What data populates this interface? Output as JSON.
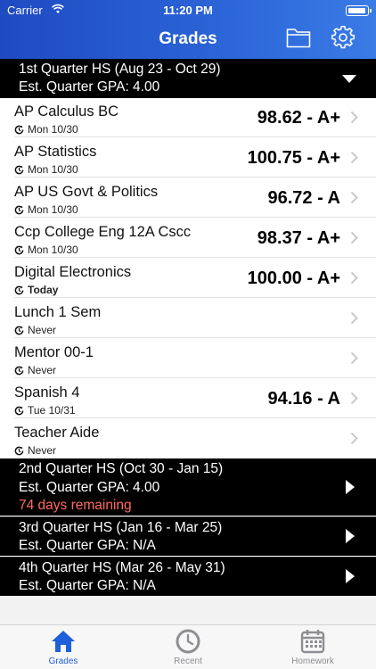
{
  "status_bar": {
    "carrier": "Carrier",
    "time": "11:20 PM"
  },
  "nav": {
    "title": "Grades"
  },
  "quarter1": {
    "title": "1st Quarter HS (Aug 23 - Oct 29)",
    "gpa": "Est. Quarter GPA: 4.00"
  },
  "courses": [
    {
      "name": "AP Calculus BC",
      "updated": "Mon 10/30",
      "grade": "98.62 - A+"
    },
    {
      "name": "AP Statistics",
      "updated": "Mon 10/30",
      "grade": "100.75 - A+"
    },
    {
      "name": "AP US Govt & Politics",
      "updated": "Mon 10/30",
      "grade": "96.72 - A"
    },
    {
      "name": "Ccp College Eng 12A Cscc",
      "updated": "Mon 10/30",
      "grade": "98.37 - A+"
    },
    {
      "name": "Digital Electronics",
      "updated": "Today",
      "grade": "100.00 - A+"
    },
    {
      "name": "Lunch 1 Sem",
      "updated": "Never",
      "grade": ""
    },
    {
      "name": "Mentor 00-1",
      "updated": "Never",
      "grade": ""
    },
    {
      "name": "Spanish 4",
      "updated": "Tue 10/31",
      "grade": "94.16 - A"
    },
    {
      "name": "Teacher Aide",
      "updated": "Never",
      "grade": ""
    }
  ],
  "quarter2": {
    "title": "2nd Quarter HS (Oct 30 - Jan 15)",
    "gpa": "Est. Quarter GPA: 4.00",
    "remaining": "74 days remaining"
  },
  "quarter3": {
    "title": "3rd Quarter HS (Jan 16 - Mar 25)",
    "gpa": "Est. Quarter GPA: N/A"
  },
  "quarter4": {
    "title": "4th Quarter HS (Mar 26 - May 31)",
    "gpa": "Est. Quarter GPA: N/A"
  },
  "tabs": {
    "grades": "Grades",
    "recent": "Recent",
    "homework": "Homework"
  },
  "colors": {
    "accent": "#1f5fd8",
    "remaining": "#ff6b5e",
    "inactive_tab": "#8e8e93"
  }
}
